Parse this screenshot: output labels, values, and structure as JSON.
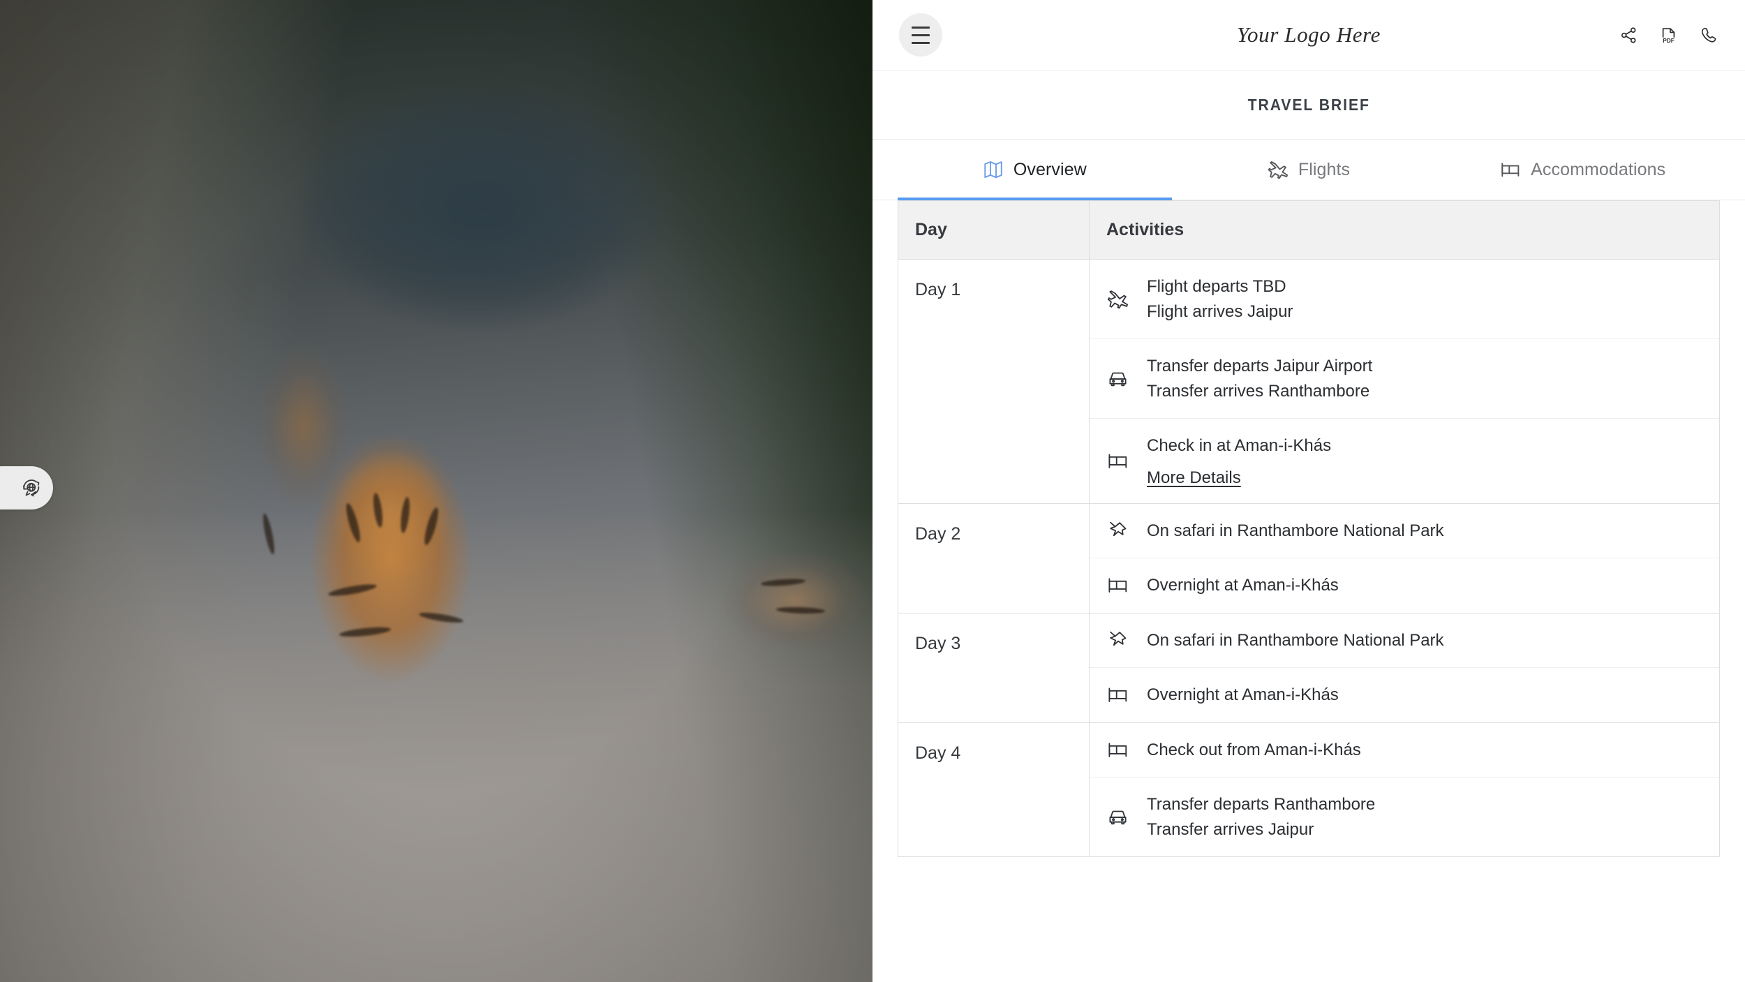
{
  "header": {
    "menu_label": "Menu",
    "logo_text": "Your Logo Here",
    "actions": [
      {
        "name": "share-icon",
        "label": "Share"
      },
      {
        "name": "pdf-icon",
        "label": "PDF"
      },
      {
        "name": "phone-icon",
        "label": "Call"
      }
    ]
  },
  "page_title": "TRAVEL BRIEF",
  "tabs": [
    {
      "label": "Overview",
      "icon": "map-icon",
      "active": true
    },
    {
      "label": "Flights",
      "icon": "plane-icon",
      "active": false
    },
    {
      "label": "Accommodations",
      "icon": "bed-icon",
      "active": false
    }
  ],
  "table": {
    "columns": {
      "day": "Day",
      "activities": "Activities"
    },
    "rows": [
      {
        "day": "Day 1",
        "activities": [
          {
            "icon": "plane-icon",
            "lines": [
              "Flight departs TBD",
              "Flight arrives Jaipur"
            ]
          },
          {
            "icon": "car-icon",
            "lines": [
              "Transfer departs Jaipur Airport",
              "Transfer arrives Ranthambore"
            ]
          },
          {
            "icon": "bed-icon",
            "lines": [
              "Check in at Aman-i-Khás"
            ],
            "link": "More Details"
          }
        ]
      },
      {
        "day": "Day 2",
        "activities": [
          {
            "icon": "pin-icon",
            "lines": [
              "On safari in Ranthambore National Park"
            ]
          },
          {
            "icon": "bed-icon",
            "lines": [
              "Overnight at Aman-i-Khás"
            ]
          }
        ]
      },
      {
        "day": "Day 3",
        "activities": [
          {
            "icon": "pin-icon",
            "lines": [
              "On safari in Ranthambore National Park"
            ]
          },
          {
            "icon": "bed-icon",
            "lines": [
              "Overnight at Aman-i-Khás"
            ]
          }
        ]
      },
      {
        "day": "Day 4",
        "activities": [
          {
            "icon": "bed-icon",
            "lines": [
              "Check out from Aman-i-Khás"
            ]
          },
          {
            "icon": "car-icon",
            "lines": [
              "Transfer departs Ranthambore",
              "Transfer arrives Jaipur"
            ]
          }
        ]
      }
    ]
  },
  "hero": {
    "alt": "Tigers walking on a dirt track in front of a safari jeep at dusk"
  },
  "translate_widget": {
    "icon": "translate-globe-icon",
    "label": "Translate"
  },
  "colors": {
    "accent": "#589bf0",
    "accent_icon": "#6b9bea",
    "text": "#2b2e32",
    "muted_text": "#77797d",
    "border": "#dedede",
    "header_bg": "#f1f1f1"
  }
}
